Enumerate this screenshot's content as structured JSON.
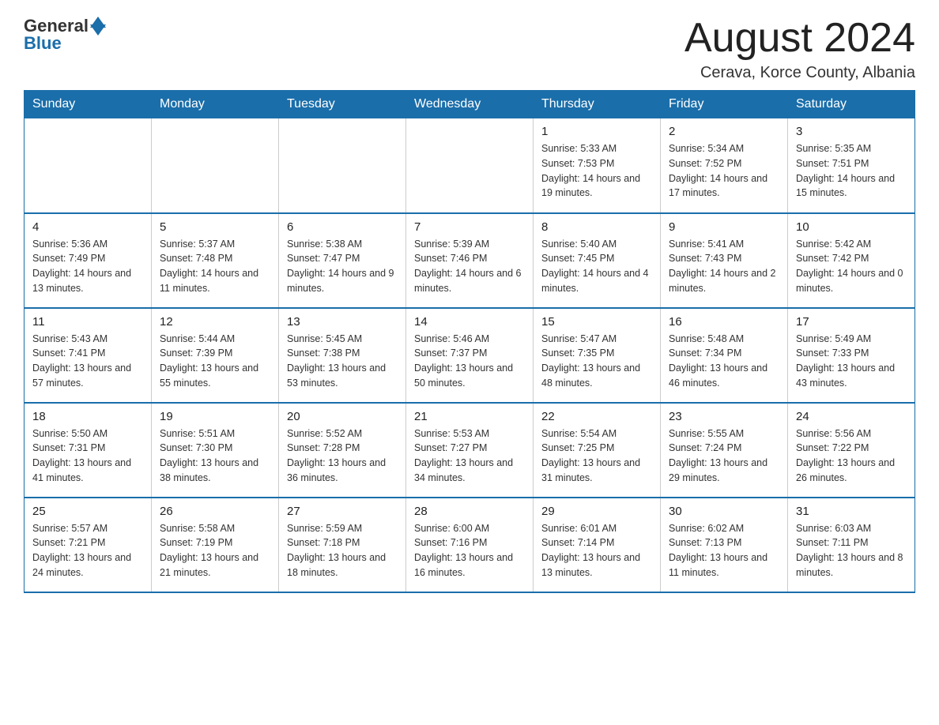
{
  "logo": {
    "general": "General",
    "blue": "Blue"
  },
  "header": {
    "month_title": "August 2024",
    "location": "Cerava, Korce County, Albania"
  },
  "weekdays": [
    "Sunday",
    "Monday",
    "Tuesday",
    "Wednesday",
    "Thursday",
    "Friday",
    "Saturday"
  ],
  "weeks": [
    [
      {
        "day": "",
        "info": ""
      },
      {
        "day": "",
        "info": ""
      },
      {
        "day": "",
        "info": ""
      },
      {
        "day": "",
        "info": ""
      },
      {
        "day": "1",
        "info": "Sunrise: 5:33 AM\nSunset: 7:53 PM\nDaylight: 14 hours and 19 minutes."
      },
      {
        "day": "2",
        "info": "Sunrise: 5:34 AM\nSunset: 7:52 PM\nDaylight: 14 hours and 17 minutes."
      },
      {
        "day": "3",
        "info": "Sunrise: 5:35 AM\nSunset: 7:51 PM\nDaylight: 14 hours and 15 minutes."
      }
    ],
    [
      {
        "day": "4",
        "info": "Sunrise: 5:36 AM\nSunset: 7:49 PM\nDaylight: 14 hours and 13 minutes."
      },
      {
        "day": "5",
        "info": "Sunrise: 5:37 AM\nSunset: 7:48 PM\nDaylight: 14 hours and 11 minutes."
      },
      {
        "day": "6",
        "info": "Sunrise: 5:38 AM\nSunset: 7:47 PM\nDaylight: 14 hours and 9 minutes."
      },
      {
        "day": "7",
        "info": "Sunrise: 5:39 AM\nSunset: 7:46 PM\nDaylight: 14 hours and 6 minutes."
      },
      {
        "day": "8",
        "info": "Sunrise: 5:40 AM\nSunset: 7:45 PM\nDaylight: 14 hours and 4 minutes."
      },
      {
        "day": "9",
        "info": "Sunrise: 5:41 AM\nSunset: 7:43 PM\nDaylight: 14 hours and 2 minutes."
      },
      {
        "day": "10",
        "info": "Sunrise: 5:42 AM\nSunset: 7:42 PM\nDaylight: 14 hours and 0 minutes."
      }
    ],
    [
      {
        "day": "11",
        "info": "Sunrise: 5:43 AM\nSunset: 7:41 PM\nDaylight: 13 hours and 57 minutes."
      },
      {
        "day": "12",
        "info": "Sunrise: 5:44 AM\nSunset: 7:39 PM\nDaylight: 13 hours and 55 minutes."
      },
      {
        "day": "13",
        "info": "Sunrise: 5:45 AM\nSunset: 7:38 PM\nDaylight: 13 hours and 53 minutes."
      },
      {
        "day": "14",
        "info": "Sunrise: 5:46 AM\nSunset: 7:37 PM\nDaylight: 13 hours and 50 minutes."
      },
      {
        "day": "15",
        "info": "Sunrise: 5:47 AM\nSunset: 7:35 PM\nDaylight: 13 hours and 48 minutes."
      },
      {
        "day": "16",
        "info": "Sunrise: 5:48 AM\nSunset: 7:34 PM\nDaylight: 13 hours and 46 minutes."
      },
      {
        "day": "17",
        "info": "Sunrise: 5:49 AM\nSunset: 7:33 PM\nDaylight: 13 hours and 43 minutes."
      }
    ],
    [
      {
        "day": "18",
        "info": "Sunrise: 5:50 AM\nSunset: 7:31 PM\nDaylight: 13 hours and 41 minutes."
      },
      {
        "day": "19",
        "info": "Sunrise: 5:51 AM\nSunset: 7:30 PM\nDaylight: 13 hours and 38 minutes."
      },
      {
        "day": "20",
        "info": "Sunrise: 5:52 AM\nSunset: 7:28 PM\nDaylight: 13 hours and 36 minutes."
      },
      {
        "day": "21",
        "info": "Sunrise: 5:53 AM\nSunset: 7:27 PM\nDaylight: 13 hours and 34 minutes."
      },
      {
        "day": "22",
        "info": "Sunrise: 5:54 AM\nSunset: 7:25 PM\nDaylight: 13 hours and 31 minutes."
      },
      {
        "day": "23",
        "info": "Sunrise: 5:55 AM\nSunset: 7:24 PM\nDaylight: 13 hours and 29 minutes."
      },
      {
        "day": "24",
        "info": "Sunrise: 5:56 AM\nSunset: 7:22 PM\nDaylight: 13 hours and 26 minutes."
      }
    ],
    [
      {
        "day": "25",
        "info": "Sunrise: 5:57 AM\nSunset: 7:21 PM\nDaylight: 13 hours and 24 minutes."
      },
      {
        "day": "26",
        "info": "Sunrise: 5:58 AM\nSunset: 7:19 PM\nDaylight: 13 hours and 21 minutes."
      },
      {
        "day": "27",
        "info": "Sunrise: 5:59 AM\nSunset: 7:18 PM\nDaylight: 13 hours and 18 minutes."
      },
      {
        "day": "28",
        "info": "Sunrise: 6:00 AM\nSunset: 7:16 PM\nDaylight: 13 hours and 16 minutes."
      },
      {
        "day": "29",
        "info": "Sunrise: 6:01 AM\nSunset: 7:14 PM\nDaylight: 13 hours and 13 minutes."
      },
      {
        "day": "30",
        "info": "Sunrise: 6:02 AM\nSunset: 7:13 PM\nDaylight: 13 hours and 11 minutes."
      },
      {
        "day": "31",
        "info": "Sunrise: 6:03 AM\nSunset: 7:11 PM\nDaylight: 13 hours and 8 minutes."
      }
    ]
  ]
}
